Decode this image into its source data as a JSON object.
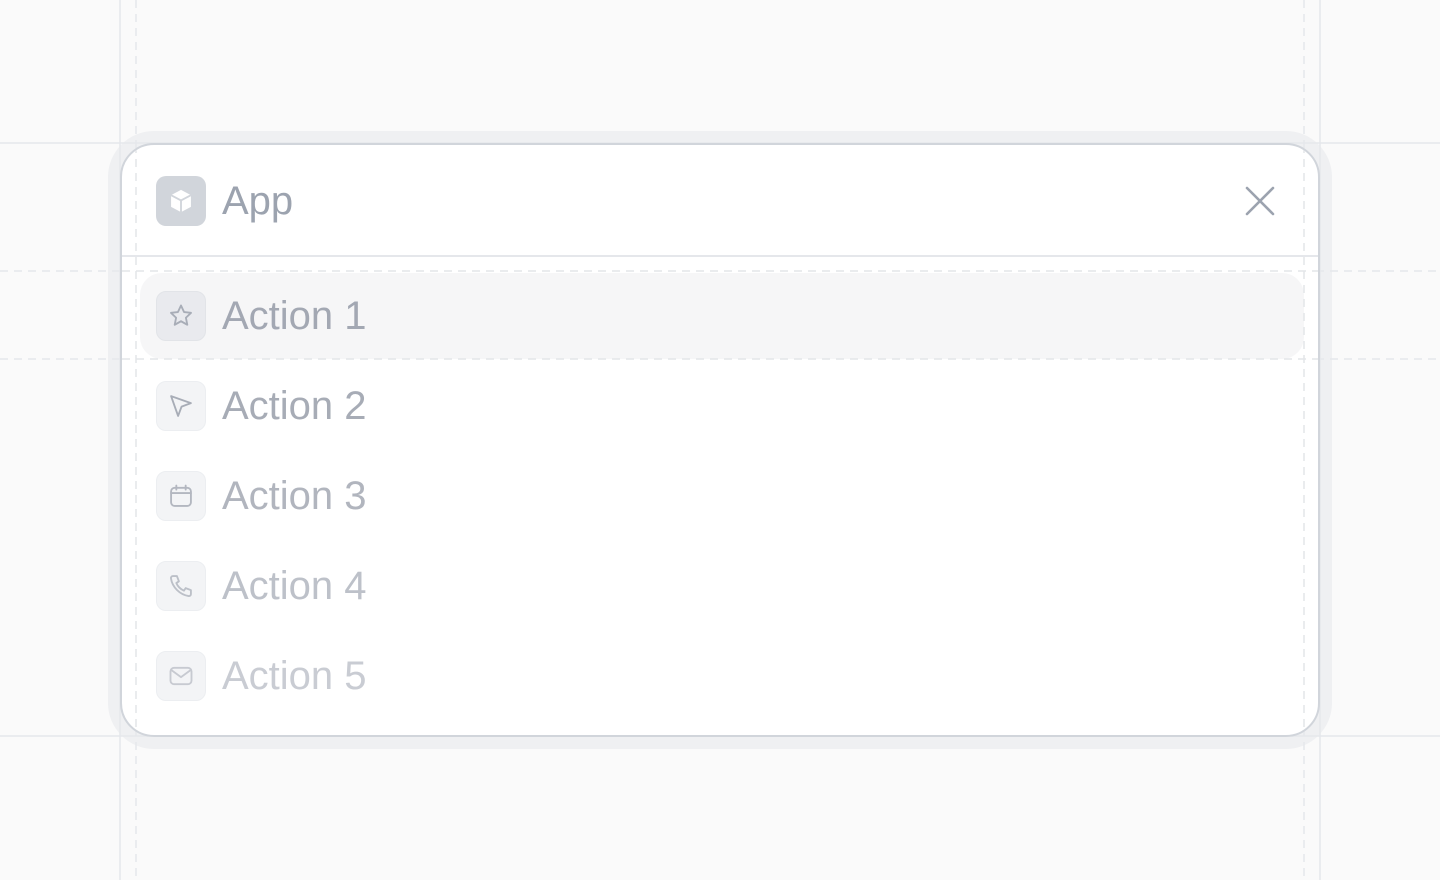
{
  "header": {
    "app_icon": "cube-icon",
    "title": "App",
    "close_icon": "close-icon"
  },
  "menu": {
    "items": [
      {
        "label": "Action 1",
        "icon": "star-icon",
        "active": true
      },
      {
        "label": "Action 2",
        "icon": "cursor-arrow-icon",
        "active": false
      },
      {
        "label": "Action 3",
        "icon": "calendar-icon",
        "active": false
      },
      {
        "label": "Action 4",
        "icon": "phone-icon",
        "active": false
      },
      {
        "label": "Action 5",
        "icon": "mail-icon",
        "active": false
      }
    ]
  },
  "colors": {
    "background": "#fafafa",
    "card": "#ffffff",
    "border": "#d1d5db",
    "active_row": "#f6f6f7",
    "text": "#9ca3af"
  }
}
